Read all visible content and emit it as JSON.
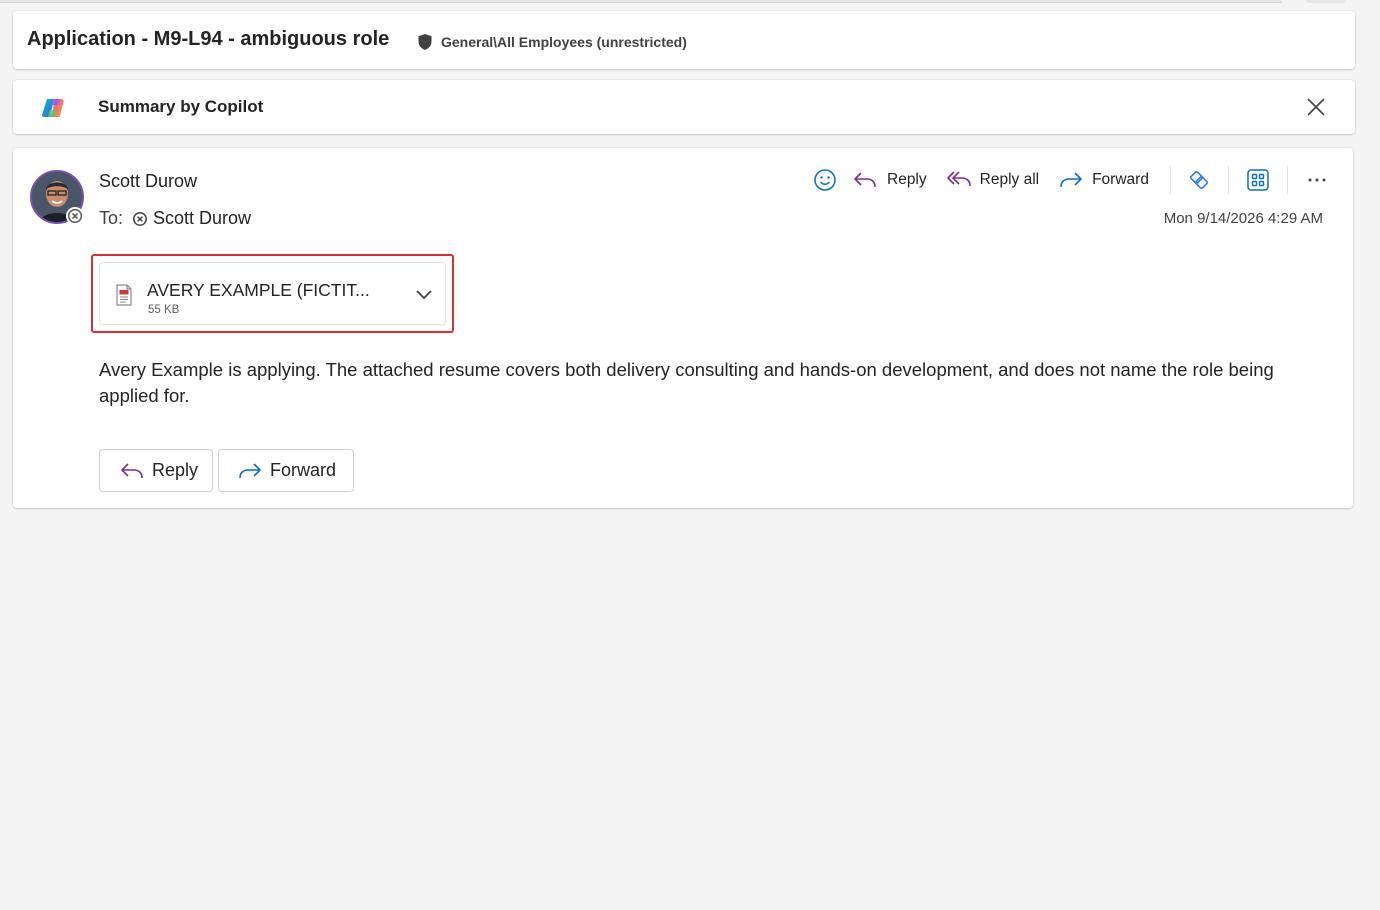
{
  "subject": {
    "title": "Application - M9-L94 - ambiguous role",
    "sensitivity_label": "General\\All Employees (unrestricted)",
    "sensitivity_icon": "shield-icon"
  },
  "copilot": {
    "label": "Summary by Copilot",
    "logo_icon": "copilot-logo-icon",
    "close_icon": "close-icon"
  },
  "message": {
    "sender": "Scott Durow",
    "to_label": "To:",
    "recipient": "Scott Durow",
    "timestamp": "Mon 9/14/2026 4:29 AM",
    "toolbar": {
      "emoji_icon": "emoji-icon",
      "reply_label": "Reply",
      "reply_all_label": "Reply all",
      "forward_label": "Forward",
      "loop_icon": "loop-icon",
      "apps_icon": "apps-icon",
      "more_icon": "more-icon"
    },
    "attachment": {
      "name": "AVERY EXAMPLE (FICTIT...",
      "size": "55 KB",
      "icon": "pdf-file-icon"
    },
    "body": "Avery Example is applying. The attached resume covers both delivery consulting and hands-on development, and does not name the role being applied for.",
    "footer": {
      "reply_label": "Reply",
      "forward_label": "Forward"
    }
  },
  "colors": {
    "accent_blue": "#0f6cbd",
    "reply_purple": "#7b2d8e",
    "highlight_red": "#d13438"
  }
}
